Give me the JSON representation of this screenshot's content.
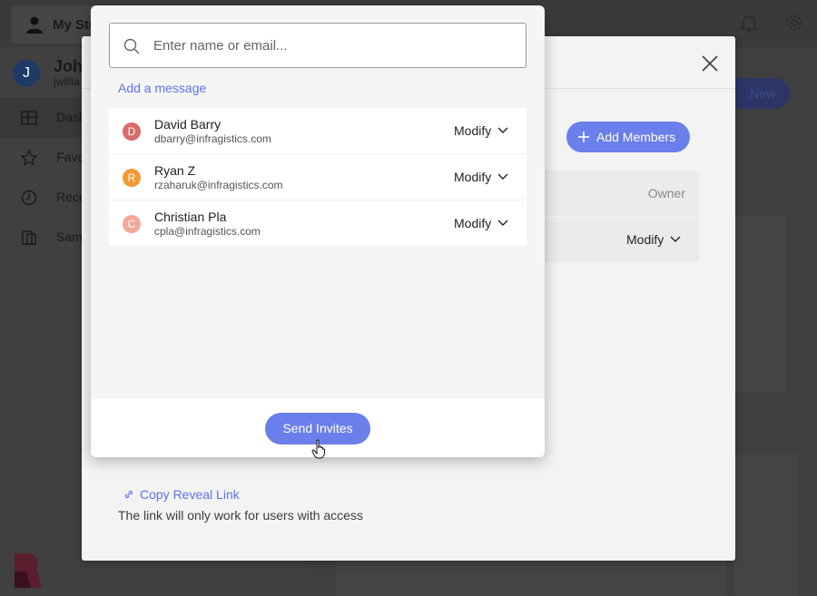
{
  "app": {
    "workspace_name": "My Stu",
    "user": {
      "initial": "J",
      "name": "Joh",
      "email": "jwillia"
    },
    "nav": [
      {
        "label": "Dash",
        "icon": "dashboard-icon"
      },
      {
        "label": "Favo",
        "icon": "star-icon"
      },
      {
        "label": "Rece",
        "icon": "clock-icon"
      },
      {
        "label": "Sam",
        "icon": "samples-icon"
      }
    ],
    "new_button_label": "New"
  },
  "share_dialog": {
    "add_members_label": "Add Members",
    "owner_label": "Owner",
    "member_permission": "Modify",
    "copy_link_label": "Copy Reveal Link",
    "link_note": "The link will only work for users with access"
  },
  "invite_dialog": {
    "search_placeholder": "Enter name or email...",
    "add_message_label": "Add a message",
    "invitees": [
      {
        "initial": "D",
        "name": "David Barry",
        "email": "dbarry@infragistics.com",
        "permission": "Modify",
        "color": "#d96b6b"
      },
      {
        "initial": "R",
        "name": "Ryan Z",
        "email": "rzaharuk@infragistics.com",
        "permission": "Modify",
        "color": "#f29a35"
      },
      {
        "initial": "C",
        "name": "Christian Pla",
        "email": "cpla@infragistics.com",
        "permission": "Modify",
        "color": "#f2a898"
      }
    ],
    "send_label": "Send Invites"
  },
  "colors": {
    "accent": "#6a7fea",
    "link": "#5b73e8"
  }
}
